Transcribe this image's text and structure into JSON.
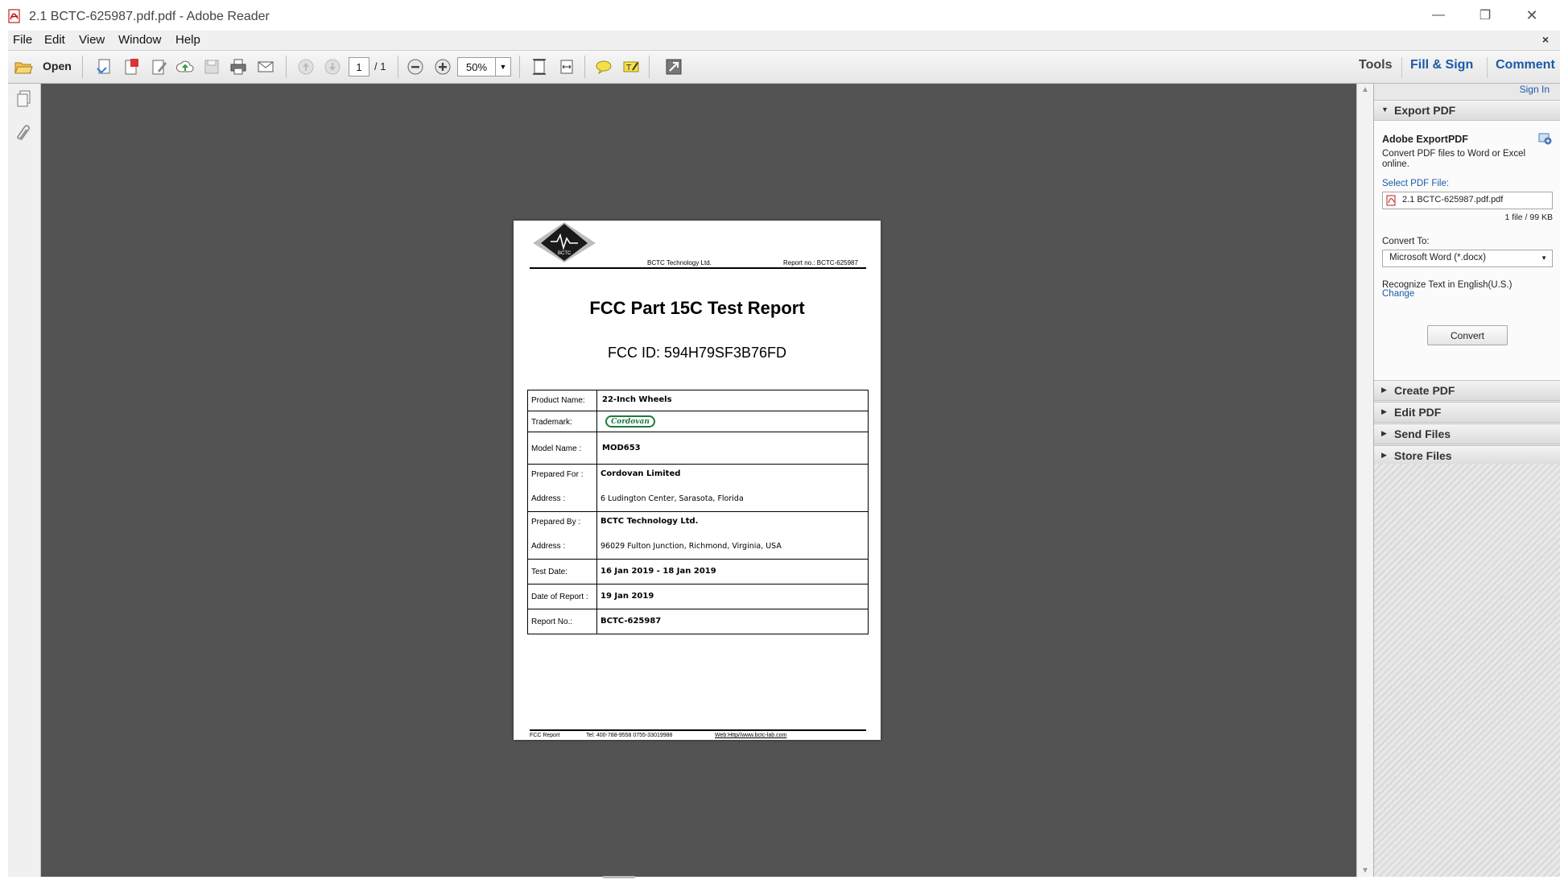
{
  "window": {
    "title": "2.1 BCTC-625987.pdf.pdf - Adobe Reader",
    "minimize": "—",
    "restore": "❐",
    "close": "✕"
  },
  "menu": {
    "items": [
      "File",
      "Edit",
      "View",
      "Window",
      "Help"
    ],
    "close_glyph": "×"
  },
  "toolbar": {
    "open_label": "Open",
    "page_current": "1",
    "page_total": "/ 1",
    "zoom": "50%",
    "tools_label": "Tools",
    "fill_sign_label": "Fill & Sign",
    "comment_label": "Comment"
  },
  "document": {
    "header_company": "BCTC Technology Ltd.",
    "header_report": "Report no.: BCTC-625987",
    "logo_text": "BCTC",
    "title": "FCC Part 15C Test Report",
    "fcc_id": "FCC ID: 594H79SF3B76FD",
    "rows": {
      "product_name_label": "Product Name:",
      "product_name": "22-Inch Wheels",
      "trademark_label": "Trademark:",
      "trademark": "Cordovan",
      "model_label": "Model Name :",
      "model": "MOD653",
      "prepared_for_label": "Prepared For :",
      "prepared_for": "Cordovan Limited",
      "address1_label": "Address :",
      "address1": "6 Ludington Center, Sarasota, Florida",
      "prepared_by_label": "Prepared By :",
      "prepared_by": "BCTC Technology Ltd.",
      "address2_label": "Address :",
      "address2": "96029 Fulton Junction, Richmond, Virginia, USA",
      "test_date_label": "Test Date:",
      "test_date": "16 Jan 2019 - 18 Jan 2019",
      "report_date_label": "Date of Report :",
      "report_date": "19 Jan 2019",
      "report_no_label": "Report No.:",
      "report_no": "BCTC-625987"
    },
    "footer_left": "FCC Report",
    "footer_tel": "Tel: 400-788-9558    0755-33019988",
    "footer_web": "Web:Http//www.bctc-lab.com"
  },
  "right_pane": {
    "sign_in": "Sign In",
    "export_pdf": "Export PDF",
    "adobe_exportpdf": "Adobe ExportPDF",
    "description": "Convert PDF files to Word or Excel online.",
    "select_file_label": "Select PDF File:",
    "selected_file": "2.1 BCTC-625987.pdf.pdf",
    "file_info": "1 file / 99 KB",
    "convert_to_label": "Convert To:",
    "convert_to_value": "Microsoft Word (*.docx)",
    "recognize_text": "Recognize Text in English(U.S.)",
    "change_link": "Change",
    "convert_button": "Convert",
    "sections": [
      "Create PDF",
      "Edit PDF",
      "Send Files",
      "Store Files"
    ]
  },
  "colors": {
    "accent_blue": "#1a5aa8",
    "doc_background": "#535353",
    "trademark_green": "#1e7a3c"
  }
}
